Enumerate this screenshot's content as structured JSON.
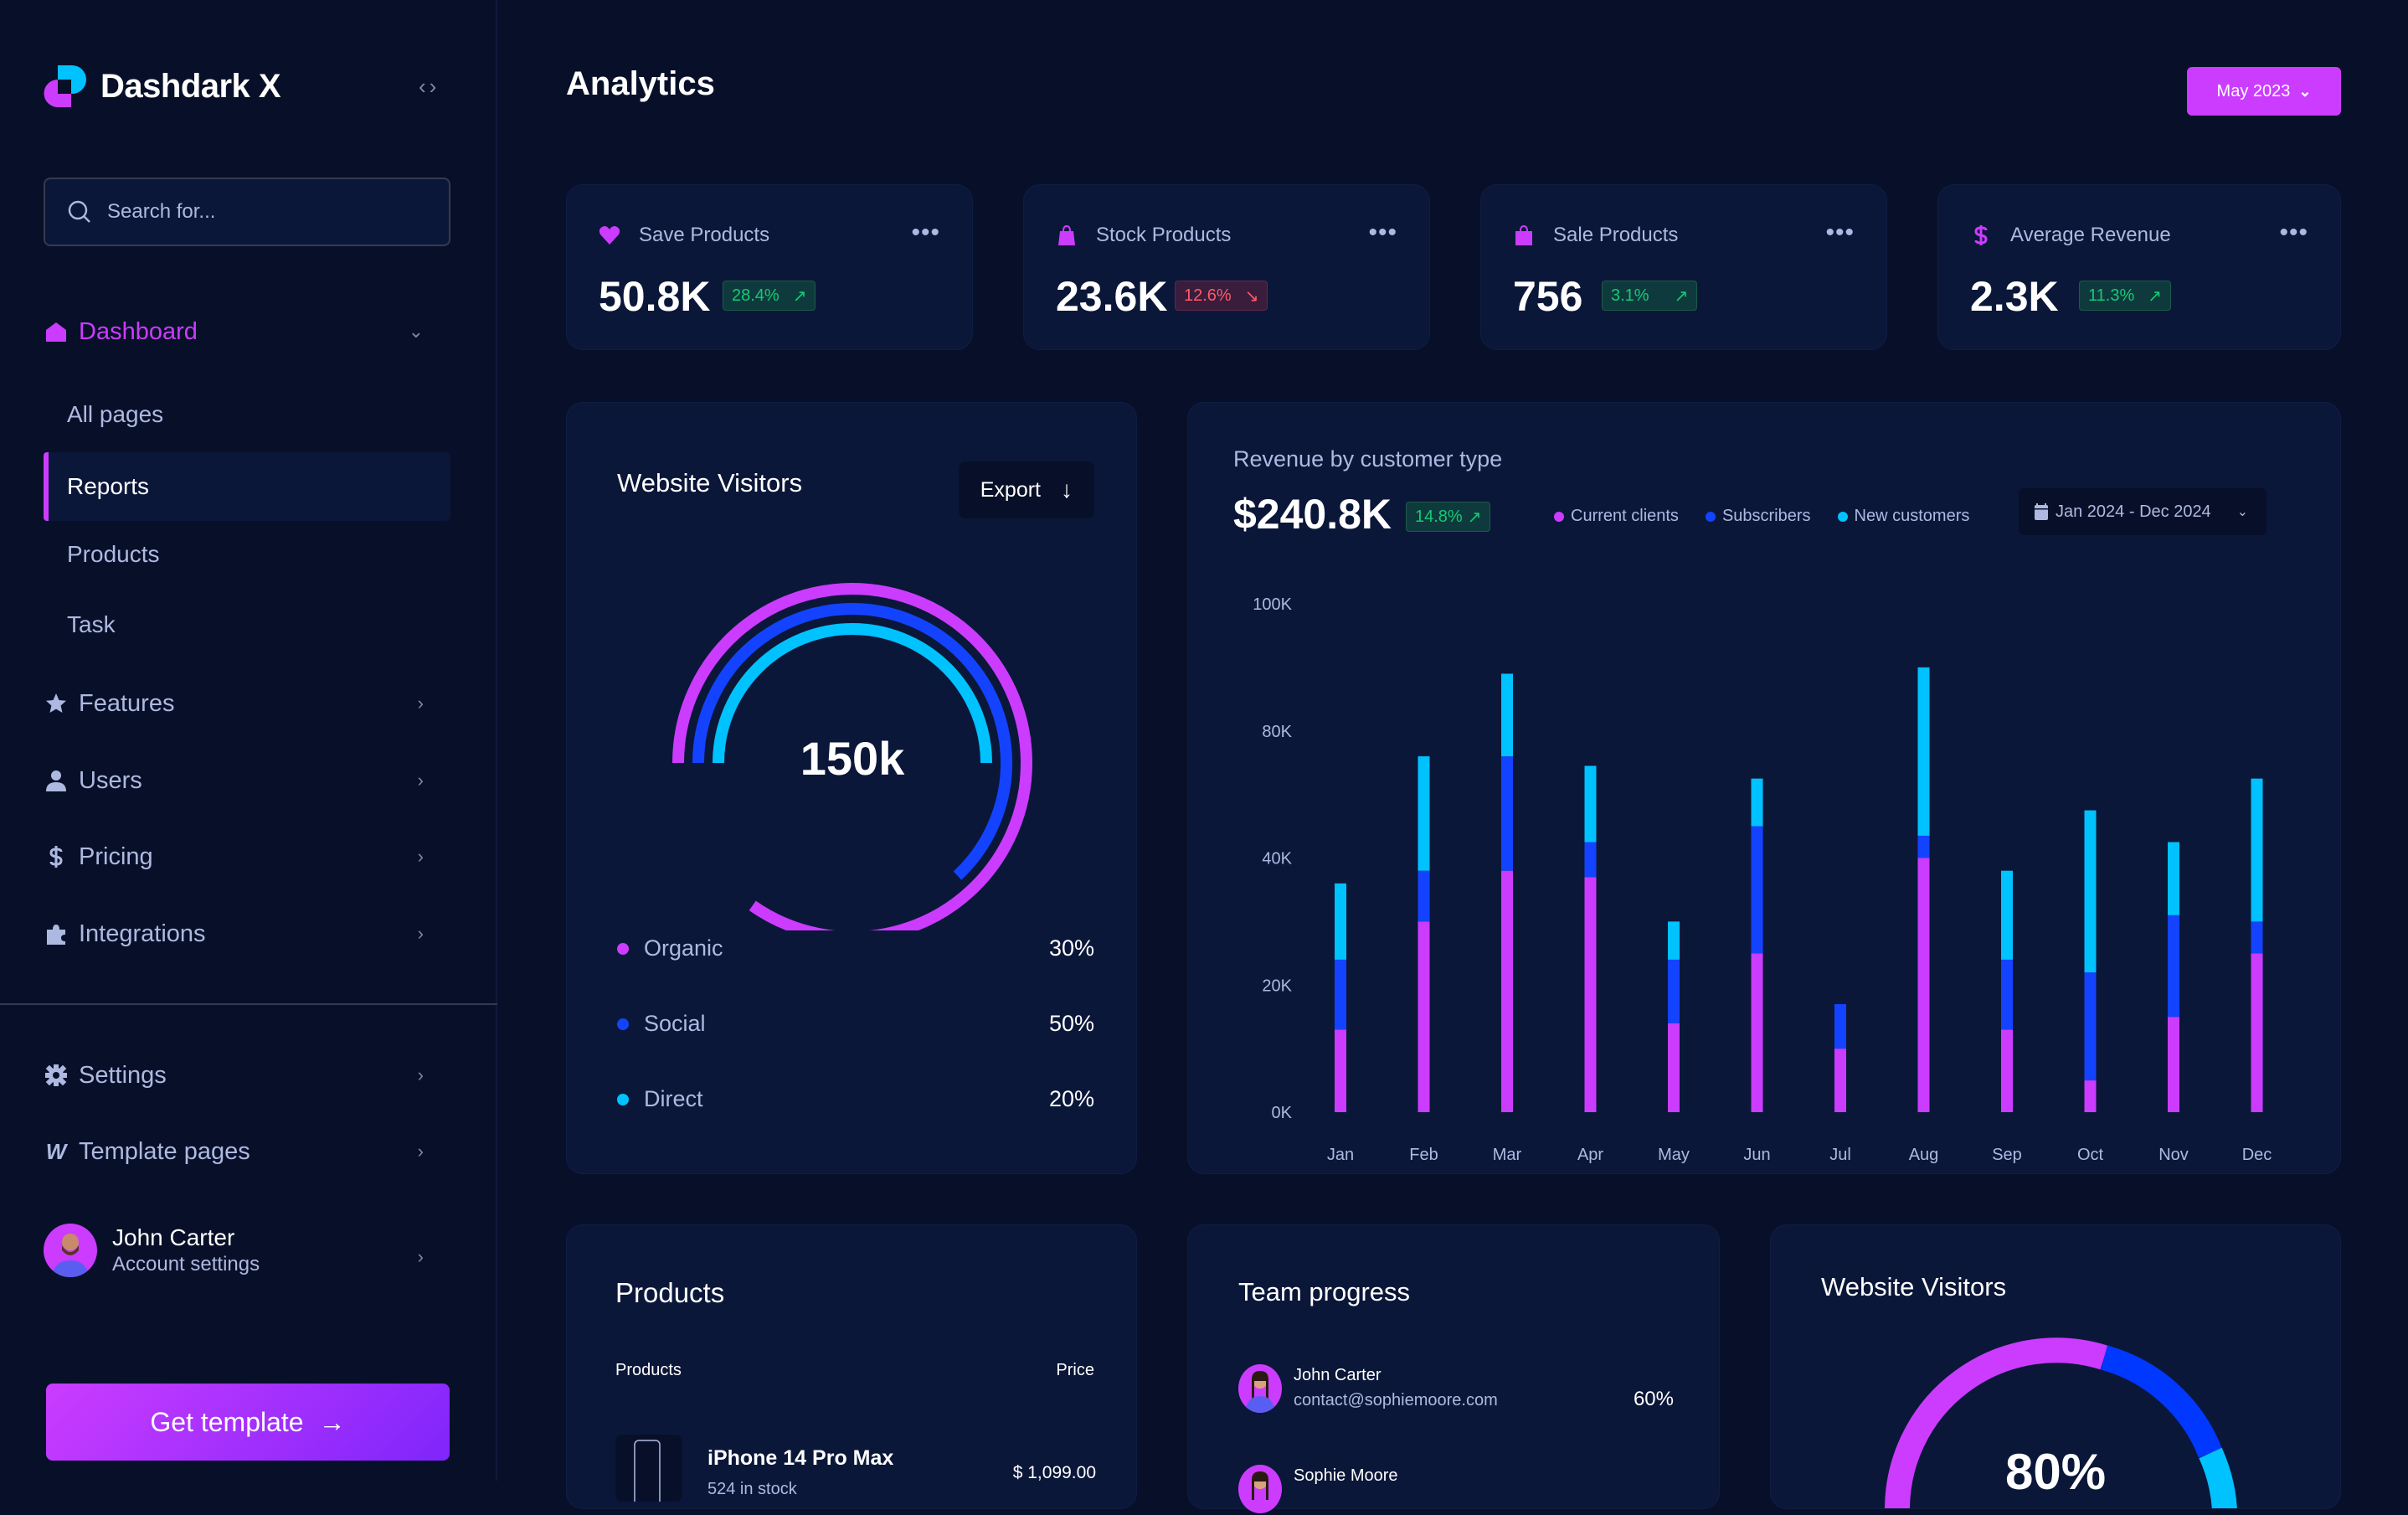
{
  "sidebar": {
    "brand": "Dashdark X",
    "collapse_icon": "code-brackets-icon",
    "search": {
      "placeholder": "Search for..."
    },
    "dashboard": {
      "label": "Dashboard",
      "icon": "home-icon"
    },
    "sub_items": [
      {
        "label": "All pages",
        "selected": false
      },
      {
        "label": "Reports",
        "selected": true
      },
      {
        "label": "Products",
        "selected": false
      },
      {
        "label": "Task",
        "selected": false
      }
    ],
    "items": [
      {
        "label": "Features",
        "icon": "star-icon"
      },
      {
        "label": "Users",
        "icon": "user-icon"
      },
      {
        "label": "Pricing",
        "icon": "dollar-icon"
      },
      {
        "label": "Integrations",
        "icon": "puzzle-icon"
      }
    ],
    "bottom_items": [
      {
        "label": "Settings",
        "icon": "gear-icon"
      },
      {
        "label": "Template pages",
        "icon": "webflow-icon"
      }
    ],
    "profile": {
      "name": "John Carter",
      "subtitle": "Account settings"
    },
    "cta": {
      "label": "Get template",
      "icon": "arrow-right-icon"
    }
  },
  "header": {
    "title": "Analytics",
    "date_button": "May 2023"
  },
  "kpis": [
    {
      "label": "Save Products",
      "icon": "heart-icon",
      "value": "50.8K",
      "change": "28.4%",
      "trend": "up"
    },
    {
      "label": "Stock Products",
      "icon": "bag-icon",
      "value": "23.6K",
      "change": "12.6%",
      "trend": "down"
    },
    {
      "label": "Sale Products",
      "icon": "bag-icon",
      "value": "756",
      "change": "3.1%",
      "trend": "up"
    },
    {
      "label": "Average Revenue",
      "icon": "dollar-icon",
      "value": "2.3K",
      "change": "11.3%",
      "trend": "up"
    }
  ],
  "visitors": {
    "title": "Website Visitors",
    "export_label": "Export",
    "total": "150k",
    "segments": [
      {
        "label": "Organic",
        "value": "30%",
        "color": "#cb3cff"
      },
      {
        "label": "Social",
        "value": "50%",
        "color": "#1443ff"
      },
      {
        "label": "Direct",
        "value": "20%",
        "color": "#00c2ff"
      }
    ]
  },
  "revenue": {
    "subtitle": "Revenue by customer type",
    "total": "$240.8K",
    "change": "14.8%",
    "range": "Jan 2024 - Dec 2024"
  },
  "chart_data": {
    "type": "bar",
    "stacked": true,
    "title": "Revenue by customer type",
    "categories": [
      "Jan",
      "Feb",
      "Mar",
      "Apr",
      "May",
      "Jun",
      "Jul",
      "Aug",
      "Sep",
      "Oct",
      "Nov",
      "Dec"
    ],
    "y_ticks": [
      "0K",
      "20K",
      "40K",
      "80K",
      "100K"
    ],
    "y_tick_values": [
      0,
      20,
      40,
      80,
      100
    ],
    "y_unit": "K",
    "legend_position": "top",
    "grid": false,
    "series": [
      {
        "name": "Current clients",
        "color": "#cb3cff",
        "values": [
          13,
          30,
          38,
          37,
          14,
          25,
          10,
          40,
          13,
          5,
          15,
          25
        ]
      },
      {
        "name": "Subscribers",
        "color": "#1443ff",
        "values": [
          11,
          8,
          34,
          8,
          10,
          25,
          7,
          7,
          11,
          17,
          16,
          5
        ]
      },
      {
        "name": "New customers",
        "color": "#00c2ff",
        "values": [
          12,
          34,
          17,
          24,
          6,
          15,
          0,
          43,
          14,
          33,
          14,
          35
        ]
      }
    ]
  },
  "products": {
    "title": "Products",
    "col_product": "Products",
    "col_price": "Price",
    "rows": [
      {
        "name": "iPhone 14 Pro Max",
        "stock": "524 in stock",
        "price": "$ 1,099.00"
      }
    ]
  },
  "team": {
    "title": "Team progress",
    "members": [
      {
        "name": "John Carter",
        "email": "contact@sophiemoore.com",
        "progress": "60%"
      },
      {
        "name": "Sophie Moore",
        "email": "",
        "progress": ""
      }
    ]
  },
  "visitors2": {
    "title": "Website Visitors",
    "value": "80%"
  }
}
